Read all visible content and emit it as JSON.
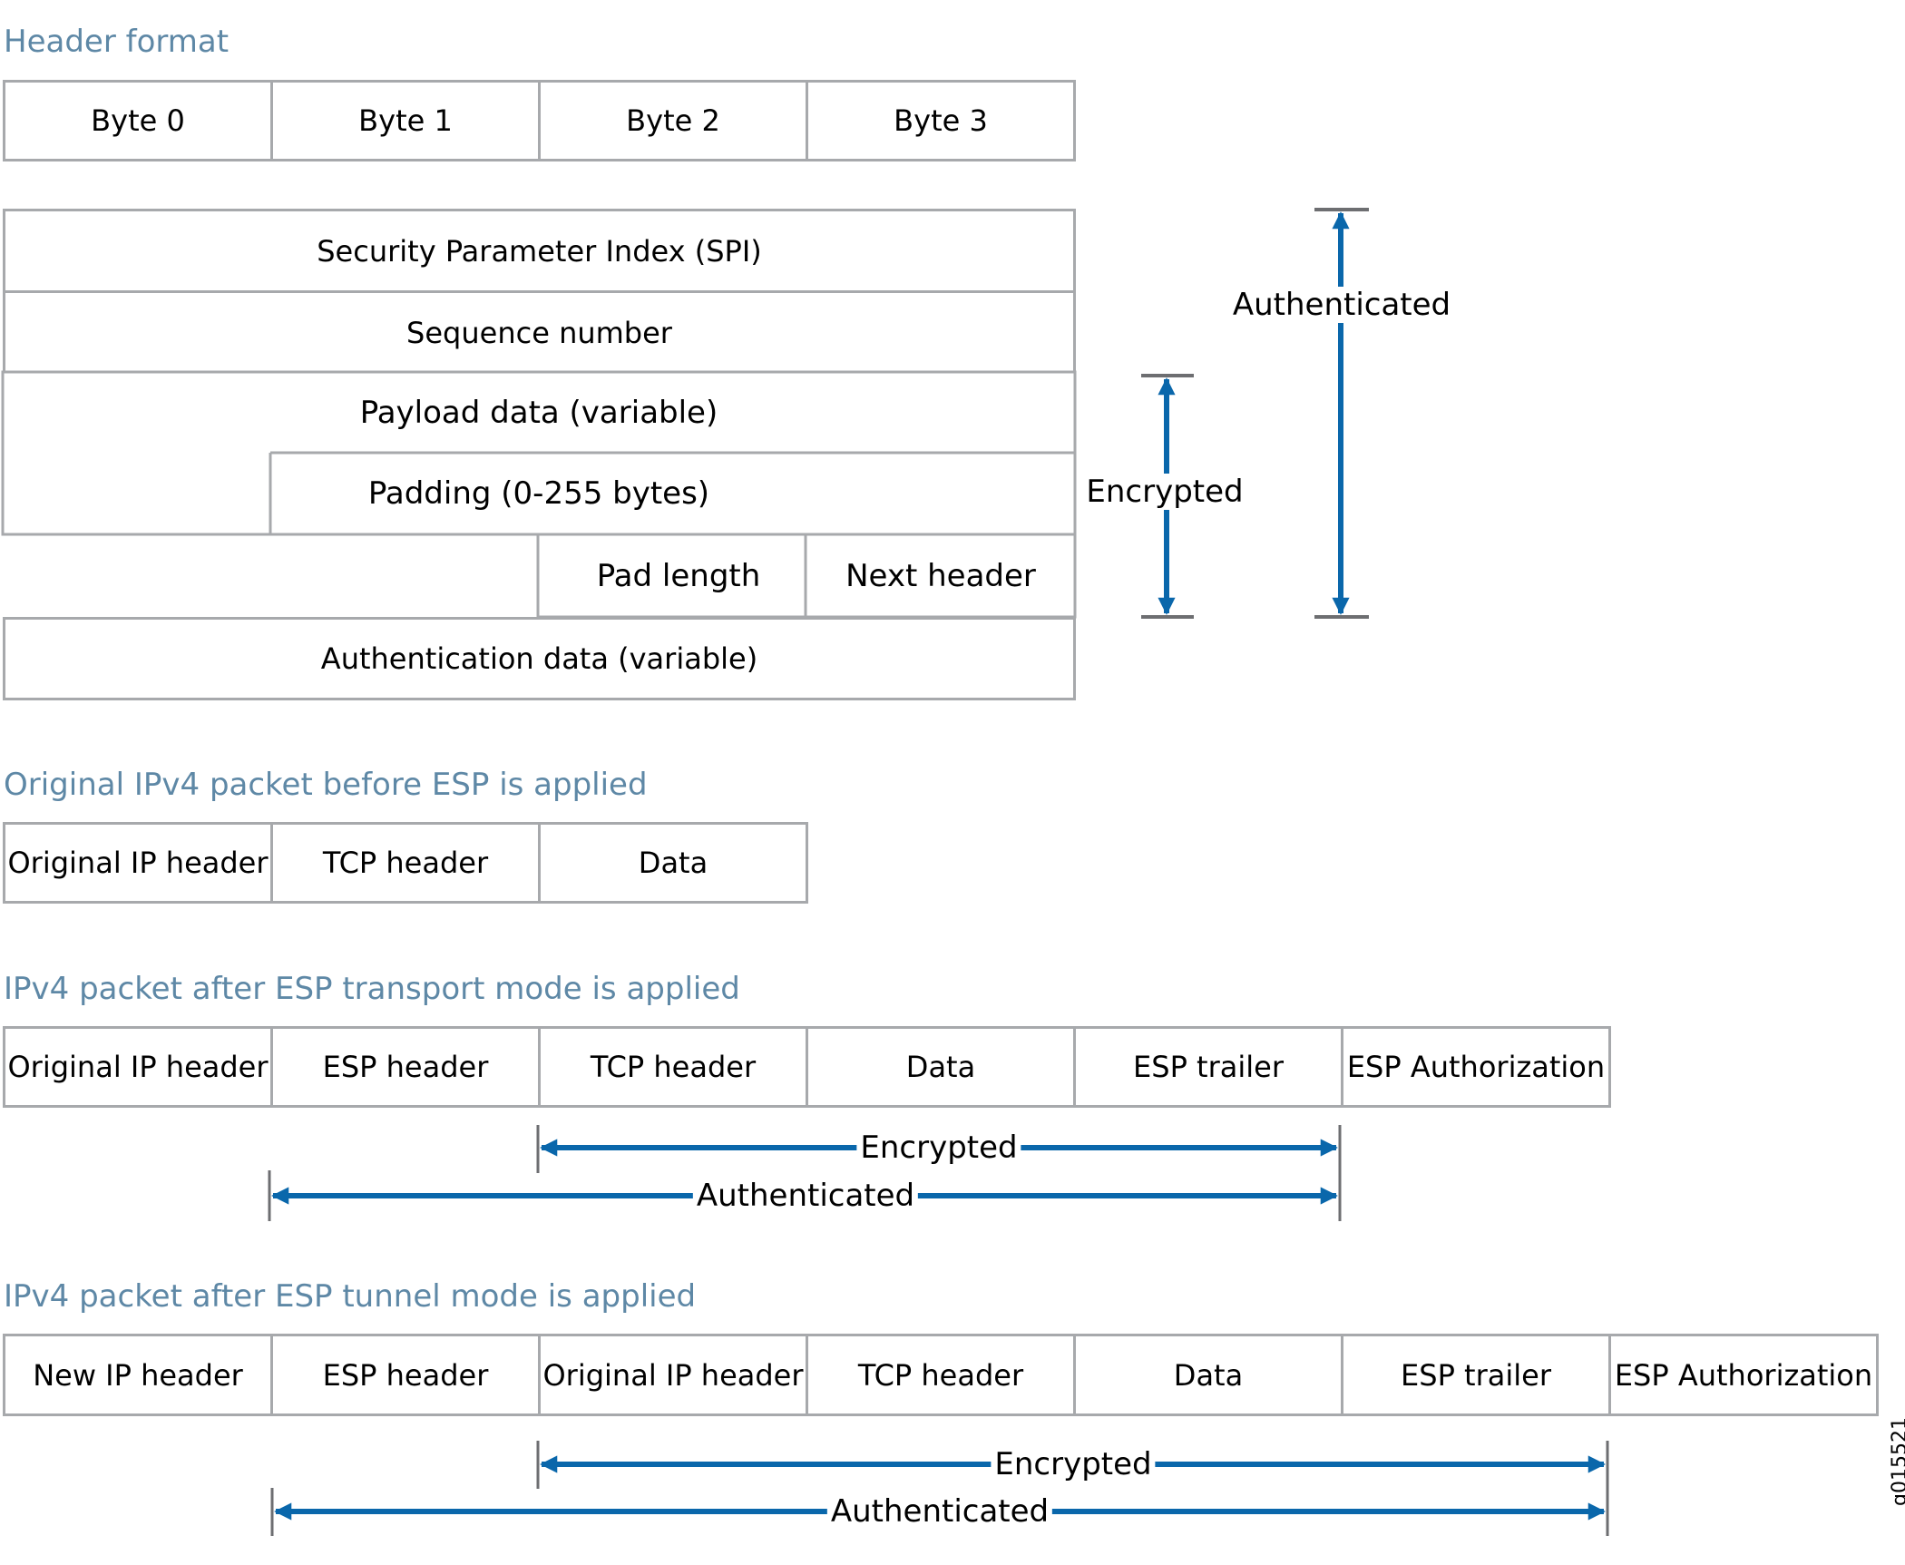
{
  "sections": {
    "header_format": {
      "title": "Header format",
      "bytes": [
        "Byte 0",
        "Byte 1",
        "Byte 2",
        "Byte 3"
      ],
      "fields": {
        "spi": "Security Parameter Index (SPI)",
        "sequence": "Sequence number",
        "payload": "Payload data (variable)",
        "padding": "Padding (0-255 bytes)",
        "pad_length": "Pad length",
        "next_header": "Next header",
        "auth_data": "Authentication data (variable)"
      },
      "encrypted_label": "Encrypted",
      "authenticated_label": "Authenticated"
    },
    "original": {
      "title": "Original IPv4 packet before ESP is applied",
      "cells": [
        "Original IP header",
        "TCP header",
        "Data"
      ]
    },
    "transport": {
      "title": "IPv4 packet after ESP transport mode is applied",
      "cells": [
        "Original IP header",
        "ESP header",
        "TCP header",
        "Data",
        "ESP trailer",
        "ESP Authorization"
      ],
      "encrypted_label": "Encrypted",
      "authenticated_label": "Authenticated"
    },
    "tunnel": {
      "title": "IPv4 packet after ESP tunnel mode is applied",
      "cells": [
        "New IP header",
        "ESP header",
        "Original IP header",
        "TCP header",
        "Data",
        "ESP trailer",
        "ESP Authorization"
      ],
      "encrypted_label": "Encrypted",
      "authenticated_label": "Authenticated"
    }
  },
  "figure_id": "g015521",
  "colors": {
    "title": "#5e88a6",
    "arrow": "#0a67ab",
    "border": "#a7a9ac",
    "tick": "#6d6e71"
  }
}
